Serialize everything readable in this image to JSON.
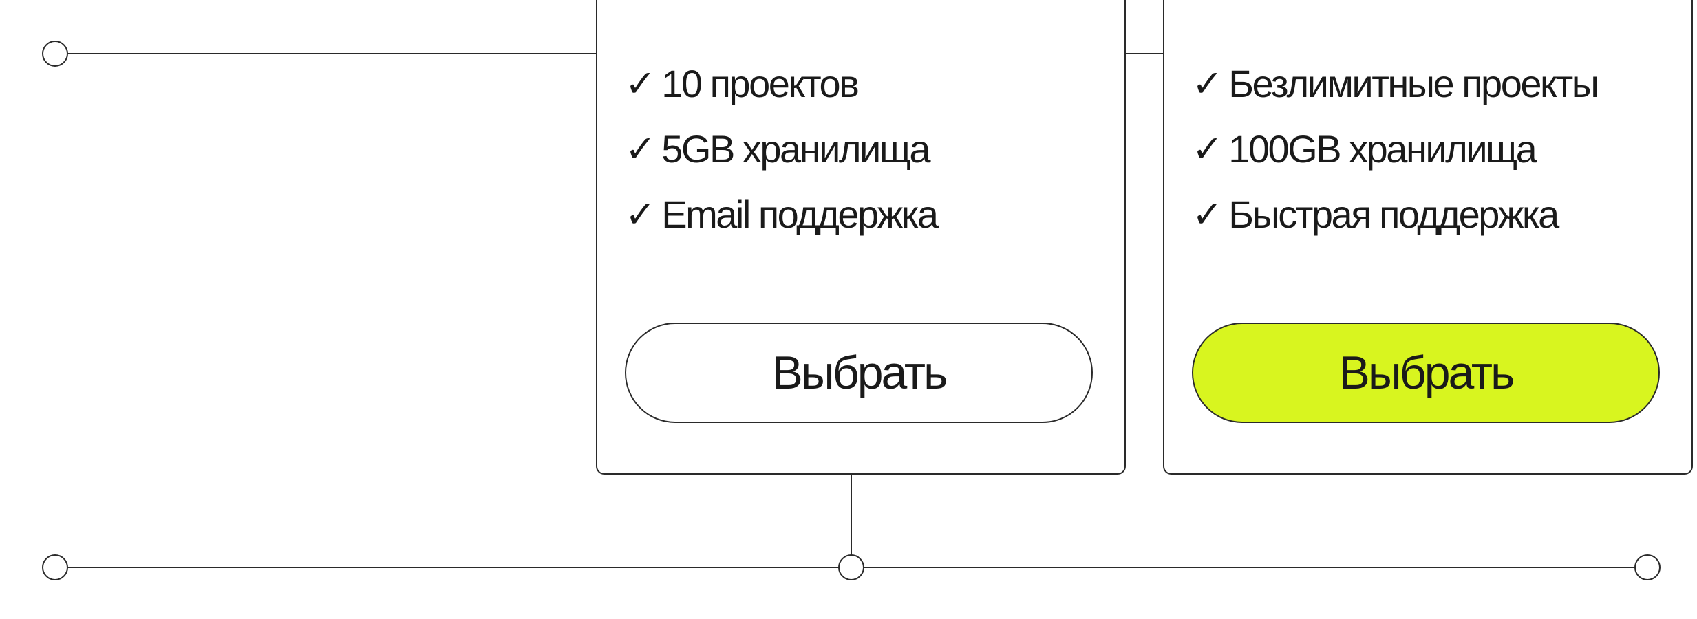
{
  "theme": {
    "accent": "#d8f51f",
    "line": "#2a2a2a"
  },
  "plans": [
    {
      "features": [
        "10 проектов",
        "5GB хранилища",
        "Email поддержка"
      ],
      "button_label": "Выбрать"
    },
    {
      "features": [
        "Безлимитные проекты",
        "100GB хранилища",
        "Быстрая поддержка"
      ],
      "button_label": "Выбрать"
    }
  ],
  "check_glyph": "✓"
}
